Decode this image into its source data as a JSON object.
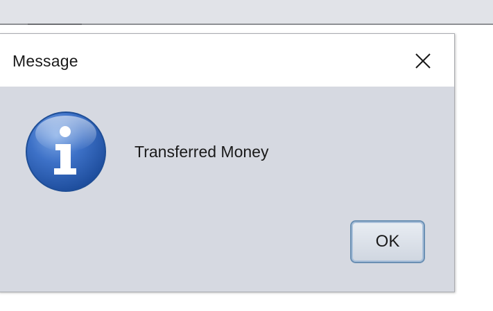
{
  "dialog": {
    "title": "Message",
    "message": "Transferred Money",
    "ok_label": "OK",
    "icon": "info-icon",
    "close_icon": "close-icon"
  },
  "colors": {
    "dialog_background": "#d6d9e1",
    "titlebar_background": "#ffffff",
    "icon_blue": "#2d61b6",
    "button_border": "#6a8fb3"
  }
}
